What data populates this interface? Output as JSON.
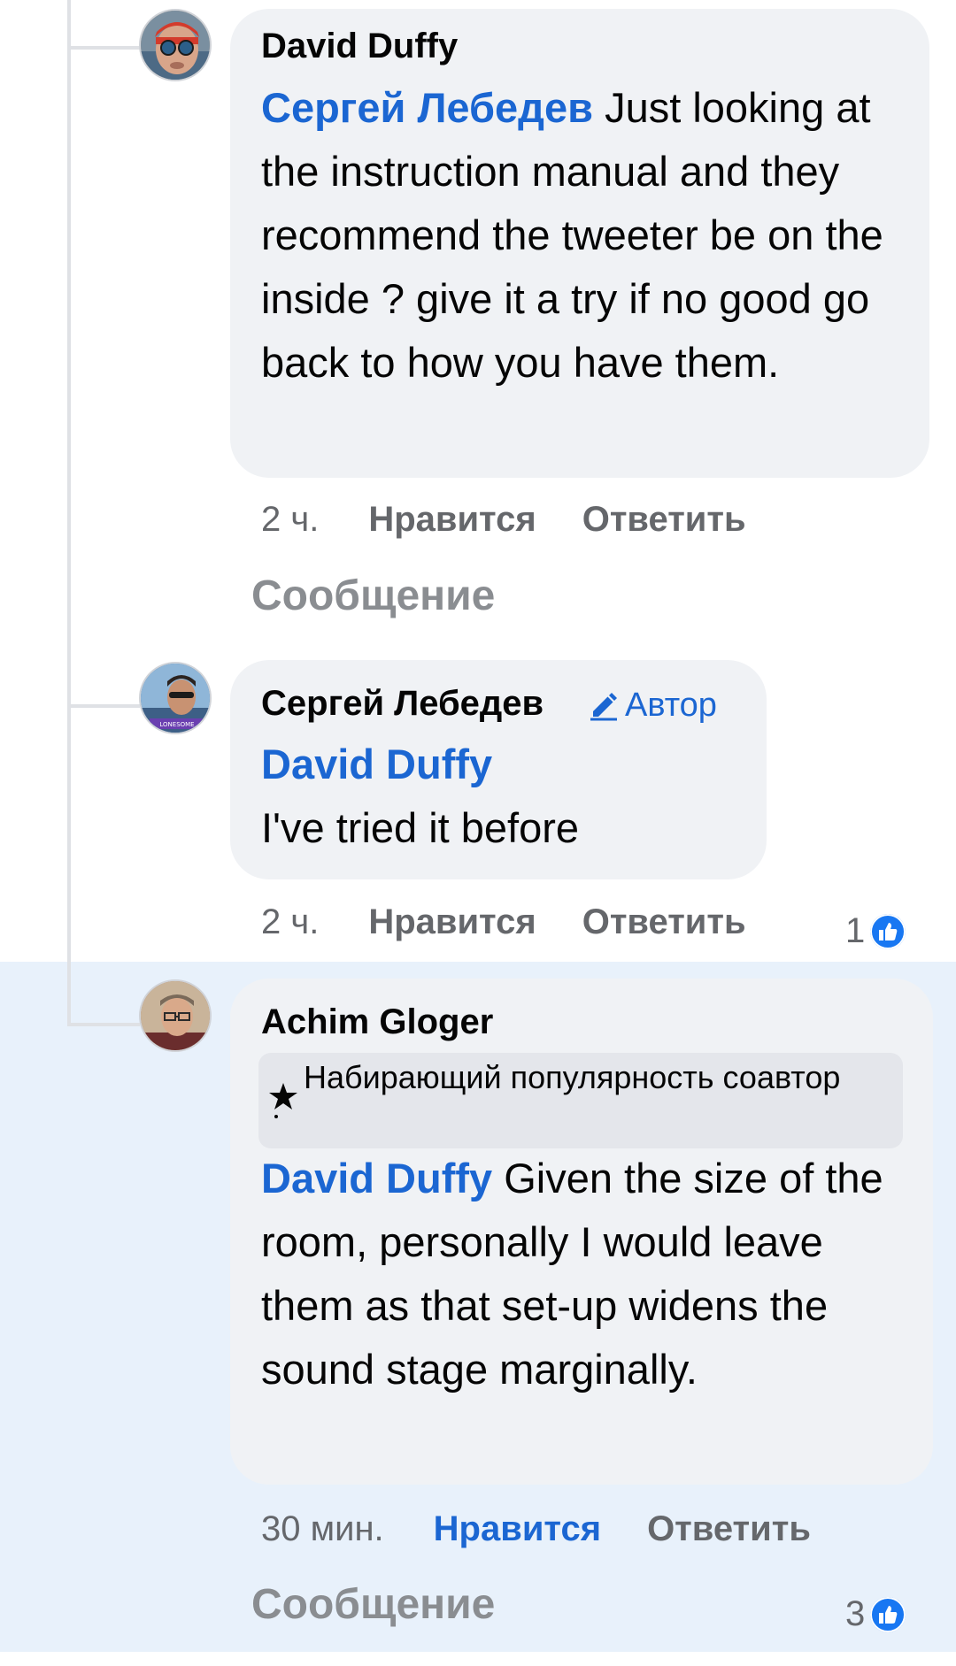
{
  "comments": [
    {
      "author": "David Duffy",
      "mention": "Сергей Лебедев",
      "text": "Just looking at the instruction manual and they recommend the tweeter be on the inside ? give it a try if no good go back to how you have them.",
      "time": "2 ч.",
      "like_label": "Нравится",
      "reply_label": "Ответить",
      "message_label": "Сообщение",
      "avatar_icon": "swimmer-avatar"
    },
    {
      "author": "Сергей Лебедев",
      "author_badge": "Автор",
      "mention": "David Duffy",
      "text": "I've tried it before",
      "time": "2 ч.",
      "like_label": "Нравится",
      "reply_label": "Ответить",
      "reaction_count": "1",
      "avatar_icon": "sunglasses-avatar"
    },
    {
      "author": "Achim Gloger",
      "tag": "Набирающий популярность соавтор",
      "tag_icon": "star-icon",
      "mention": "David Duffy",
      "text": "Given the size of the room, personally I would leave them as that set-up widens the sound stage marginally.",
      "time": "30 мин.",
      "like_label": "Нравится",
      "reply_label": "Ответить",
      "message_label": "Сообщение",
      "reaction_count": "3",
      "avatar_icon": "man-glasses-avatar"
    }
  ],
  "colors": {
    "mention": "#1b66d2",
    "like_active": "#1b66d2",
    "bubble": "#f0f2f5",
    "highlight": "#e8f1fb",
    "like_icon": "#1877f2"
  }
}
